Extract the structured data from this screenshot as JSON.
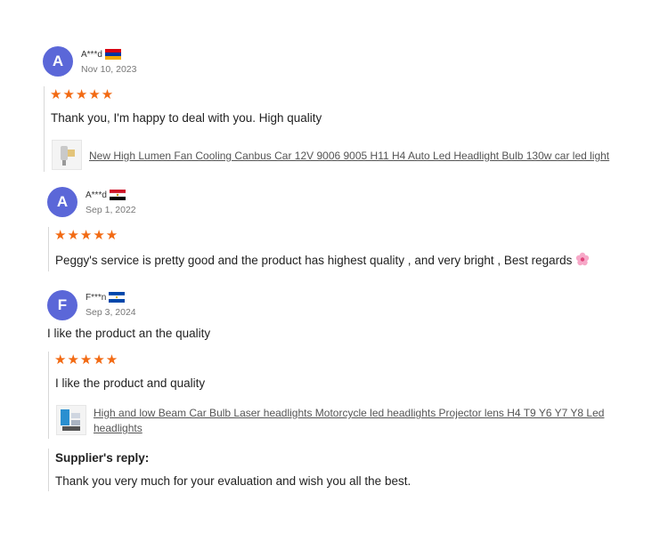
{
  "reviews": [
    {
      "initial": "A",
      "name": "A***d",
      "flag": "armenia-flag",
      "date": "Nov 10, 2023",
      "stars": "★★★★★",
      "rating": 5,
      "text": "Thank you, I'm happy to deal with you. High quality",
      "product": "New High Lumen Fan Cooling Canbus Car 12V 9006 9005 H11 H4 Auto Led Headlight Bulb 130w car led light"
    },
    {
      "initial": "A",
      "name": "A***d",
      "flag": "egypt-flag",
      "date": "Sep 1, 2022",
      "stars": "★★★★★",
      "rating": 5,
      "text": "Peggy's service is pretty good and the product has highest quality , and very bright , Best regards"
    },
    {
      "initial": "F",
      "name": "F***n",
      "flag": "el-salvador-flag",
      "date": "Sep 3, 2024",
      "comment": "I like the product an the quality",
      "stars": "★★★★★",
      "rating": 5,
      "text": "I like the product and quality",
      "product_line1": "High and low Beam Car Bulb Laser headlights Motorcycle led headlights Projector lens H4 T9 Y6 Y7 Y8 Led",
      "product_line2": "headlights",
      "reply_title": "Supplier's reply:",
      "reply_text": "Thank you very much for your evaluation and wish you all the best."
    }
  ],
  "colors": {
    "avatar": "#5b67d8",
    "stars": "#f26a13"
  }
}
